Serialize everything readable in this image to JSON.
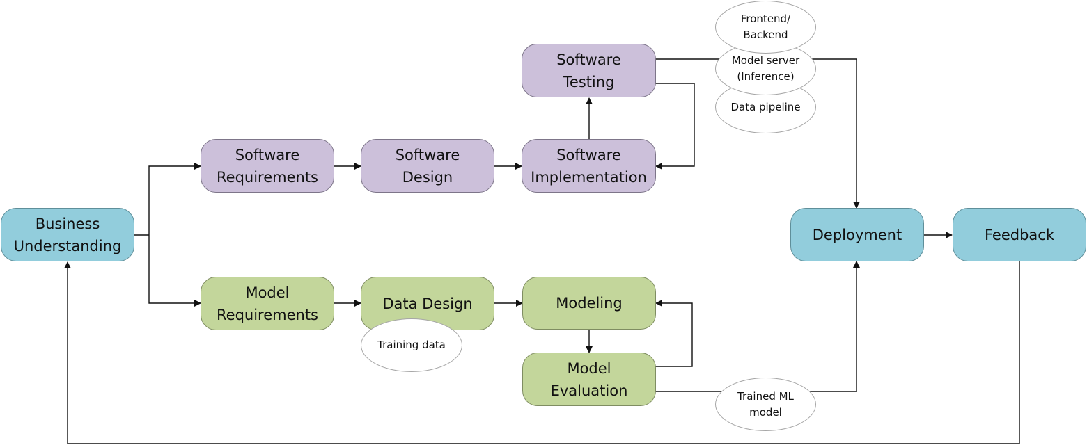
{
  "diagram": {
    "nodes": {
      "business_understanding": "Business\nUnderstanding",
      "software_requirements": "Software\nRequirements",
      "software_design": "Software\nDesign",
      "software_implementation": "Software\nImplementation",
      "software_testing": "Software\nTesting",
      "model_requirements": "Model\nRequirements",
      "data_design": "Data Design",
      "modeling": "Modeling",
      "model_evaluation": "Model\nEvaluation",
      "deployment": "Deployment",
      "feedback": "Feedback"
    },
    "artifacts": {
      "frontend_backend": "Frontend/\nBackend",
      "model_server": "Model server\n(Inference)",
      "data_pipeline": "Data pipeline",
      "training_data": "Training data",
      "trained_ml_model": "Trained ML\nmodel"
    },
    "colors": {
      "business_phase": "#92cddc",
      "software_track": "#ccc0da",
      "ml_track": "#c3d69b",
      "artifact": "#ffffff"
    },
    "edges": [
      {
        "from": "Business Understanding",
        "to": "Software Requirements"
      },
      {
        "from": "Business Understanding",
        "to": "Model Requirements"
      },
      {
        "from": "Software Requirements",
        "to": "Software Design"
      },
      {
        "from": "Software Design",
        "to": "Software Implementation"
      },
      {
        "from": "Software Implementation",
        "to": "Software Testing"
      },
      {
        "from": "Software Testing",
        "to": "Software Implementation"
      },
      {
        "from": "Software Testing",
        "to": "Deployment",
        "via": "Frontend/Backend, Model server (Inference), Data pipeline"
      },
      {
        "from": "Model Requirements",
        "to": "Data Design"
      },
      {
        "from": "Data Design",
        "to": "Modeling",
        "artifact": "Training data"
      },
      {
        "from": "Modeling",
        "to": "Model Evaluation"
      },
      {
        "from": "Model Evaluation",
        "to": "Modeling"
      },
      {
        "from": "Model Evaluation",
        "to": "Deployment",
        "via": "Trained ML model"
      },
      {
        "from": "Deployment",
        "to": "Feedback"
      },
      {
        "from": "Feedback",
        "to": "Business Understanding"
      }
    ]
  }
}
